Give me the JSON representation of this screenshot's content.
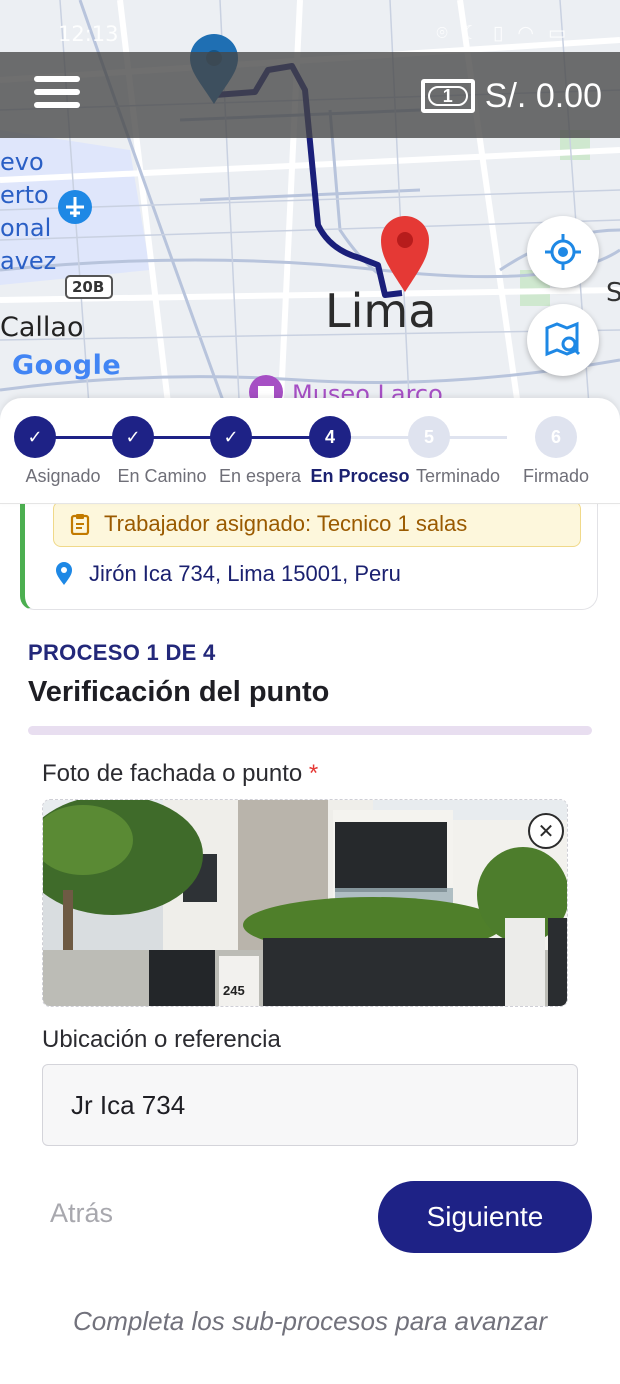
{
  "status_bar": {
    "time": "12:13",
    "icons": "⌾ ☾ ▯ ◠ ▭"
  },
  "header": {
    "balance": "S/. 0.00",
    "menu_icon": "hamburger-icon",
    "wallet_icon": "banknote-icon"
  },
  "map": {
    "labels": {
      "city": "Lima",
      "district": "Callao",
      "airport_lines": [
        "evo",
        "erto",
        "onal",
        "avez"
      ],
      "museum": "Museo Larco",
      "highway": "20B",
      "brand": "Google",
      "edge_letter": "S"
    }
  },
  "stepper": {
    "steps": [
      {
        "number": "✓",
        "label": "Asignado",
        "state": "done"
      },
      {
        "number": "✓",
        "label": "En Camino",
        "state": "done"
      },
      {
        "number": "✓",
        "label": "En espera",
        "state": "done"
      },
      {
        "number": "4",
        "label": "En Proceso",
        "state": "active"
      },
      {
        "number": "5",
        "label": "Terminado",
        "state": "pending"
      },
      {
        "number": "6",
        "label": "Firmado",
        "state": "pending"
      }
    ]
  },
  "order_card": {
    "worker": "Trabajador asignado: Tecnico 1 salas",
    "address": "Jirón Ica 734, Lima 15001, Peru"
  },
  "process": {
    "kicker": "PROCESO 1 DE 4",
    "title": "Verificación del punto",
    "photo_label": "Foto de fachada o punto",
    "required_mark": "*",
    "house_number": "245",
    "location_label": "Ubicación o referencia",
    "location_value": "Jr Ica 734"
  },
  "actions": {
    "back": "Atrás",
    "next": "Siguiente"
  },
  "hint": "Completa los sub-procesos para avanzar",
  "colors": {
    "primary": "#1e2286",
    "done_green": "#4caf50",
    "route": "#1a1f7a",
    "pending": "#dfe3ef"
  }
}
